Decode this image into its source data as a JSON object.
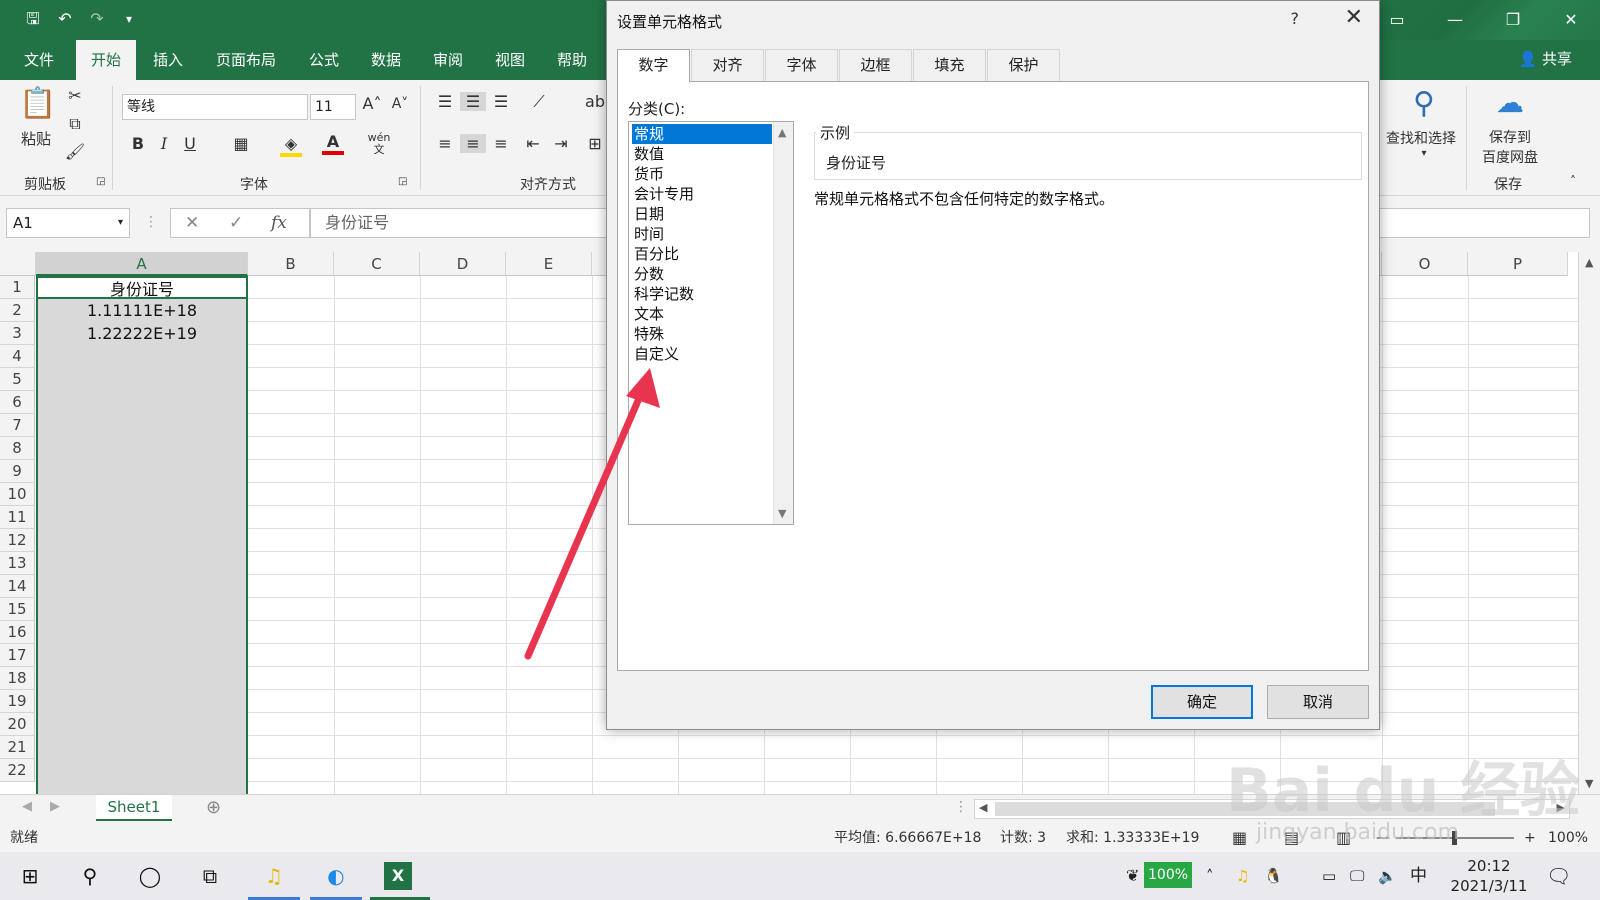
{
  "ribbon": {
    "tabs": [
      "文件",
      "开始",
      "插入",
      "页面布局",
      "公式",
      "数据",
      "审阅",
      "视图",
      "帮助"
    ],
    "share": "共享",
    "paste": "粘贴",
    "clipboard_group": "剪贴板",
    "font_name": "等线",
    "font_size": "11",
    "font_group": "字体",
    "align_group": "对齐方式",
    "find_select": "查找和选择",
    "save_to": "保存到",
    "baidu_pan": "百度网盘",
    "save_group": "保存",
    "bold": "B",
    "italic": "I",
    "underline": "U",
    "font_color": "A",
    "wen": "wén"
  },
  "formula_bar": {
    "name_box": "A1",
    "fx": "fx",
    "cancel": "✕",
    "enter": "✓",
    "content": "身份证号"
  },
  "grid": {
    "columns_left": [
      "A",
      "B",
      "C",
      "D",
      "E"
    ],
    "columns_right": [
      "O",
      "P"
    ],
    "rows": [
      "1",
      "2",
      "3",
      "4",
      "5",
      "6",
      "7",
      "8",
      "9",
      "10",
      "11",
      "12",
      "13",
      "14",
      "15",
      "16",
      "17",
      "18",
      "19",
      "20",
      "21",
      "22"
    ],
    "cells": [
      "身份证号",
      "1.11111E+18",
      "1.22222E+19"
    ]
  },
  "sheet": {
    "tab": "Sheet1"
  },
  "status": {
    "ready": "就绪",
    "average": "平均值: 6.66667E+18",
    "count": "计数: 3",
    "sum": "求和: 1.33333E+19",
    "zoom": "100%"
  },
  "dialog": {
    "title": "设置单元格格式",
    "help": "?",
    "tabs": [
      "数字",
      "对齐",
      "字体",
      "边框",
      "填充",
      "保护"
    ],
    "category_label": "分类(C):",
    "categories": [
      "常规",
      "数值",
      "货币",
      "会计专用",
      "日期",
      "时间",
      "百分比",
      "分数",
      "科学记数",
      "文本",
      "特殊",
      "自定义"
    ],
    "sample_legend": "示例",
    "sample_value": "身份证号",
    "description": "常规单元格格式不包含任何特定的数字格式。",
    "ok": "确定",
    "cancel": "取消"
  },
  "taskbar": {
    "battery": "100%",
    "ime": "中",
    "time": "20:12",
    "date": "2021/3/11"
  },
  "watermark": {
    "brand": "Bai du 经验",
    "url": "jingyan.baidu.com"
  },
  "colors": {
    "excel_green": "#217346",
    "selection_blue": "#0078d7",
    "arrow_red": "#e8344e"
  }
}
